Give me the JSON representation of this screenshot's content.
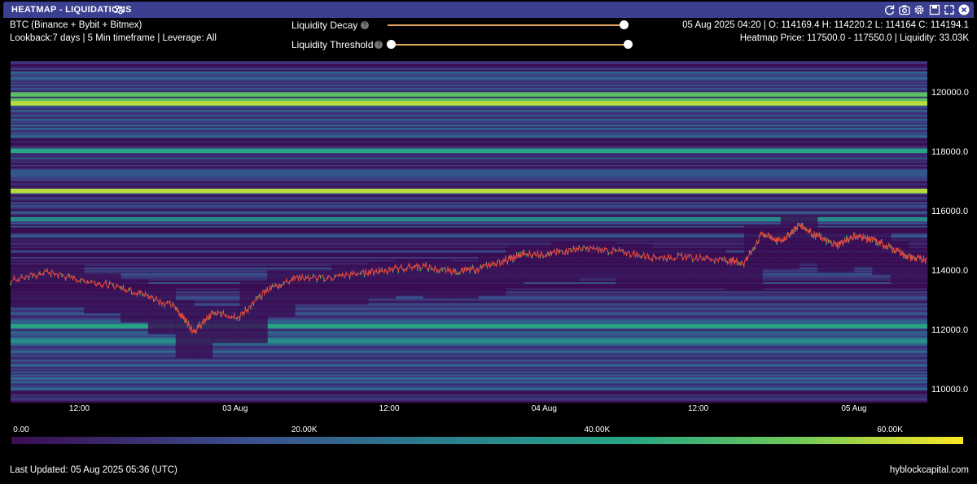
{
  "window": {
    "title": "HEATMAP - LIQUIDATIONS",
    "icons": [
      "filter-icon",
      "refresh-icon",
      "camera-icon",
      "settings-icon",
      "save-icon",
      "expand-icon",
      "close-icon"
    ]
  },
  "info": {
    "symbol": "BTC (Binance + Bybit + Bitmex)",
    "params": "Lookback:7 days | 5 Min timeframe | Leverage: All",
    "ohlc": "05 Aug 2025 04:20 | O: 114169.4 H: 114220.2 L: 114164 C: 114194.1",
    "heatmap": "Heatmap Price: 117500.0 - 117550.0 | Liquidity: 33.03K"
  },
  "controls": {
    "decay_label": "Liquidity Decay",
    "threshold_label": "Liquidity Threshold",
    "help_glyph": "?",
    "decay_value": 1.0,
    "threshold_value": 0.0
  },
  "footer": {
    "updated": "Last Updated: 05 Aug 2025 05:36 (UTC)",
    "brand": "hyblockcapital.com"
  },
  "colors": {
    "accent": "#e2a45c",
    "titlebar": "#3b3f8f",
    "candle_up": "#2ecc71",
    "candle_down": "#e74c3c"
  },
  "chart_data": {
    "type": "heatmap",
    "yaxis": {
      "ticks": [
        "120000.0",
        "118000.0",
        "116000.0",
        "114000.0",
        "112000.0",
        "110000.0"
      ],
      "range": [
        109600,
        121100
      ]
    },
    "xaxis": {
      "ticks": [
        "12:00",
        "03 Aug",
        "12:00",
        "04 Aug",
        "12:00",
        "05 Aug"
      ]
    },
    "colorbar": {
      "ticks": [
        "0.00",
        "20.00K",
        "40.00K",
        "60.00K"
      ],
      "range": [
        0,
        65000
      ]
    },
    "price_series": {
      "t": [
        0,
        0.04,
        0.08,
        0.12,
        0.15,
        0.18,
        0.2,
        0.22,
        0.25,
        0.28,
        0.31,
        0.35,
        0.39,
        0.42,
        0.45,
        0.48,
        0.51,
        0.54,
        0.56,
        0.59,
        0.62,
        0.66,
        0.7,
        0.74,
        0.78,
        0.8,
        0.82,
        0.84,
        0.86,
        0.88,
        0.9,
        0.92,
        0.94,
        0.96,
        0.98,
        1.0
      ],
      "price": [
        113700,
        114000,
        113700,
        113500,
        113200,
        112800,
        112000,
        112600,
        112500,
        113400,
        113800,
        113800,
        114000,
        114100,
        114200,
        114000,
        114100,
        114400,
        114600,
        114600,
        114800,
        114700,
        114500,
        114500,
        114400,
        114300,
        115300,
        115000,
        115600,
        115200,
        114900,
        115200,
        115100,
        114800,
        114500,
        114400
      ]
    }
  }
}
